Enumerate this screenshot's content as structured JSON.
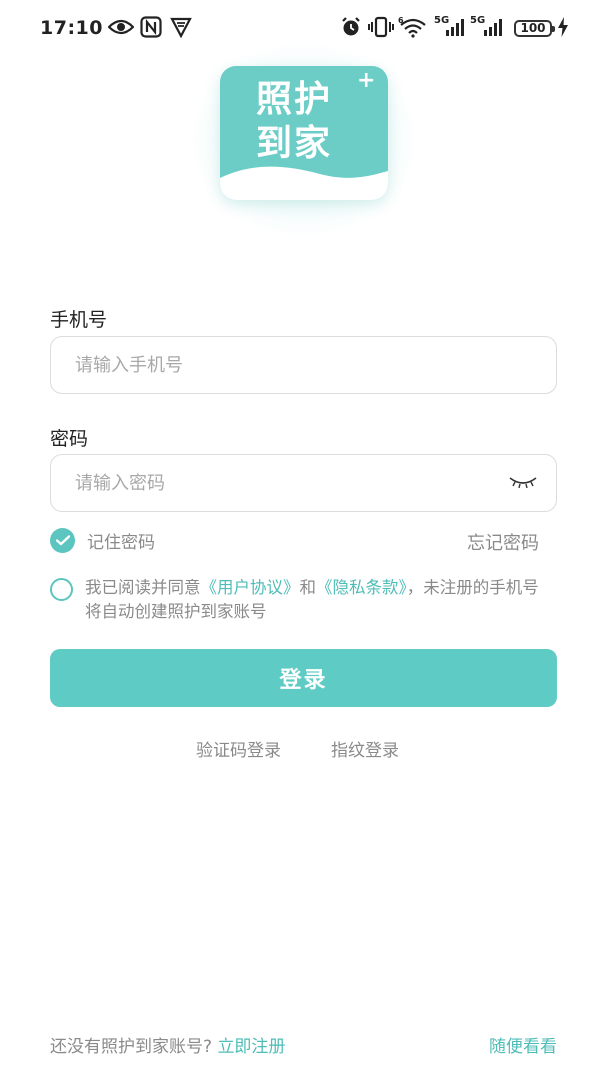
{
  "status_bar": {
    "time": "17:10",
    "network_1": "5G",
    "network_2": "5G",
    "battery": "100"
  },
  "logo": {
    "line1": "照护",
    "line2": "到家",
    "plus": "+"
  },
  "form": {
    "phone_label": "手机号",
    "phone_placeholder": "请输入手机号",
    "password_label": "密码",
    "password_placeholder": "请输入密码",
    "remember_label": "记住密码",
    "forgot_label": "忘记密码"
  },
  "agreement": {
    "prefix": "我已阅读并同意",
    "user_agreement": "《用户协议》",
    "and": "和",
    "privacy": "《隐私条款》",
    "suffix": "，未注册的手机号将自动创建照护到家账号"
  },
  "login_button": "登录",
  "alt_login": {
    "sms": "验证码登录",
    "fingerprint": "指纹登录"
  },
  "footer": {
    "question": "还没有照护到家账号? ",
    "register": "立即注册",
    "browse": "随便看看"
  },
  "colors": {
    "accent": "#5fcbc5",
    "link": "#4fbdb7"
  },
  "icons": [
    "eye-icon",
    "nfc-icon",
    "shield-icon",
    "alarm-icon",
    "vibrate-icon",
    "wifi-icon",
    "signal-icon",
    "battery-icon",
    "charging-icon",
    "eye-closed-icon",
    "check-icon"
  ]
}
